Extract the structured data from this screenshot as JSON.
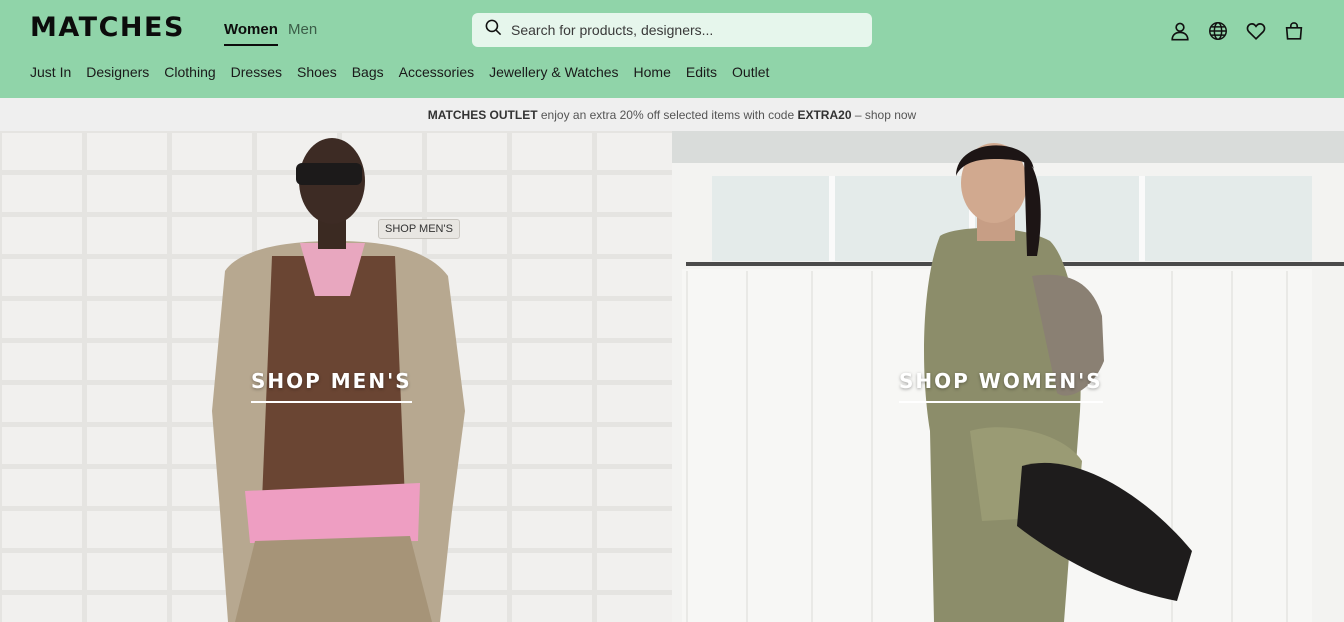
{
  "header": {
    "logo": "MATCHES",
    "gender_tabs": [
      {
        "label": "Women",
        "active": true
      },
      {
        "label": "Men",
        "active": false
      }
    ],
    "search": {
      "placeholder": "Search for products, designers..."
    },
    "icons": [
      "account-icon",
      "globe-icon",
      "wishlist-heart-icon",
      "shopping-bag-icon"
    ],
    "nav_items": [
      "Just In",
      "Designers",
      "Clothing",
      "Dresses",
      "Shoes",
      "Bags",
      "Accessories",
      "Jewellery & Watches",
      "Home",
      "Edits",
      "Outlet"
    ]
  },
  "banner": {
    "brand": "MATCHES OUTLET",
    "text": " enjoy an extra 20% off selected items with code ",
    "code": "EXTRA20",
    "suffix": " – shop now"
  },
  "hero": {
    "men": {
      "label": "SHOP MEN'S",
      "tooltip": "SHOP MEN'S"
    },
    "women": {
      "label": "SHOP WOMEN'S"
    }
  },
  "colors": {
    "header_bg": "#90d4a9",
    "banner_bg": "#efefef"
  }
}
